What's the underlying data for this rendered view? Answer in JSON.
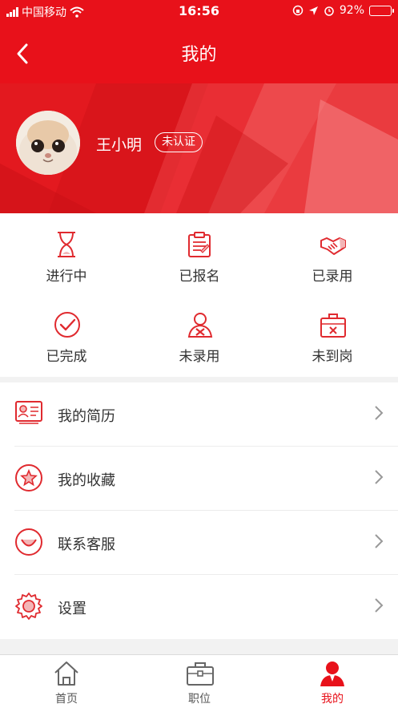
{
  "status_bar": {
    "carrier": "中国移动",
    "time": "16:56",
    "battery": "92%",
    "battery_level": 0.92
  },
  "header": {
    "title": "我的"
  },
  "profile": {
    "name": "王小明",
    "verify_badge": "未认证"
  },
  "statuses": [
    {
      "label": "进行中",
      "icon": "hourglass-icon"
    },
    {
      "label": "已报名",
      "icon": "clipboard-icon"
    },
    {
      "label": "已录用",
      "icon": "handshake-icon"
    },
    {
      "label": "已完成",
      "icon": "check-circle-icon"
    },
    {
      "label": "未录用",
      "icon": "user-x-icon"
    },
    {
      "label": "未到岗",
      "icon": "briefcase-x-icon"
    }
  ],
  "menu": [
    {
      "label": "我的简历",
      "icon": "resume-icon"
    },
    {
      "label": "我的收藏",
      "icon": "star-circle-icon"
    },
    {
      "label": "联系客服",
      "icon": "smile-circle-icon"
    },
    {
      "label": "设置",
      "icon": "gear-icon"
    }
  ],
  "tabs": [
    {
      "label": "首页",
      "icon": "home-icon"
    },
    {
      "label": "职位",
      "icon": "briefcase-icon"
    },
    {
      "label": "我的",
      "icon": "person-icon",
      "active": true
    }
  ],
  "colors": {
    "brand": "#e8111a",
    "icon_outline": "#e02a2f"
  }
}
